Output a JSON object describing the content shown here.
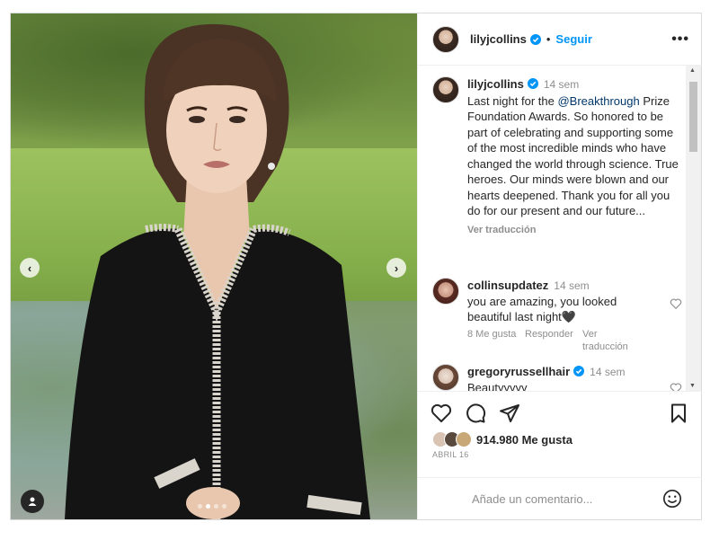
{
  "post": {
    "username": "lilyjcollins",
    "follow_label": "Seguir",
    "separator": "•",
    "more_label": "•••"
  },
  "caption": {
    "username": "lilyjcollins",
    "time": "14 sem",
    "text_before_mention": "Last night for the ",
    "mention": "@Breakthrough",
    "text_after_mention": " Prize Foundation Awards. So honored to be part of celebrating and supporting some of the most incredible minds who have changed the world through science. True heroes. Our minds were blown and our hearts deepened. Thank you for all you do for our present and our future...",
    "see_translation": "Ver traducción"
  },
  "comments": [
    {
      "username": "collinsupdatez",
      "time": "14 sem",
      "text": "you are amazing, you looked beautiful last night🖤",
      "likes": "8 Me gusta",
      "reply": "Responder",
      "translate": "Ver traducción"
    },
    {
      "username": "gregoryrussellhair",
      "time": "14 sem",
      "text": "Beautyyyyy"
    }
  ],
  "likes": {
    "count_text": "914.980 Me gusta"
  },
  "date": "ABRIL 16",
  "comment_input": {
    "placeholder": "Añade un comentario..."
  },
  "carousel": {
    "slides": 4,
    "active_index": 1
  },
  "colors": {
    "accent": "#0095f6",
    "text": "#262626",
    "muted": "#8e8e8e",
    "mention": "#00376b"
  },
  "icons": [
    "chevron-left-icon",
    "chevron-right-icon",
    "user-tag-icon",
    "verified-badge-icon",
    "more-options-icon",
    "heart-icon",
    "comment-icon",
    "share-icon",
    "bookmark-icon",
    "emoji-icon"
  ]
}
